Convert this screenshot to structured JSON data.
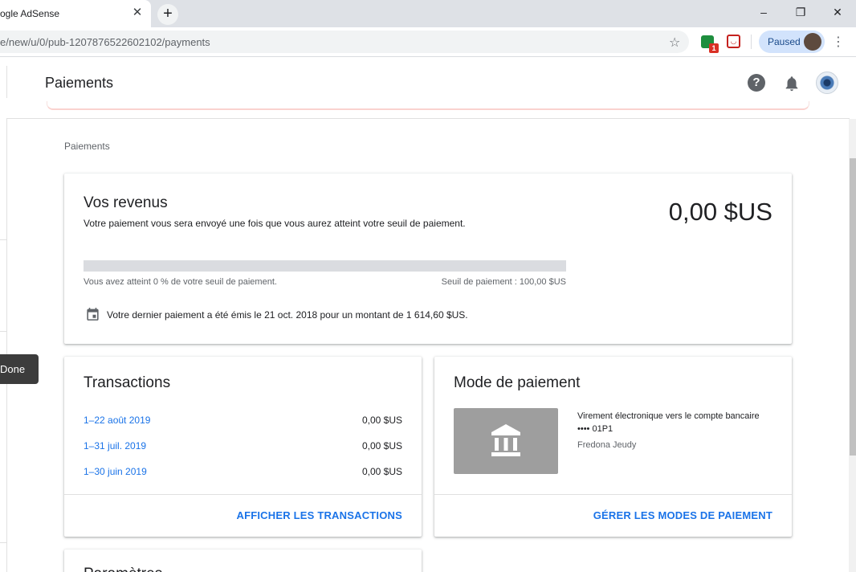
{
  "browser": {
    "tab_title": "ogle AdSense",
    "url": "e/new/u/0/pub-1207876522602102/payments",
    "extension_badge": "1",
    "profile_status": "Paused"
  },
  "app": {
    "page_title": "Paiements",
    "breadcrumb": "Paiements"
  },
  "tooltip": {
    "label": "Done"
  },
  "revenue": {
    "title": "Vos revenus",
    "description": "Votre paiement vous sera envoyé une fois que vous aurez atteint votre seuil de paiement.",
    "amount": "0,00 $US",
    "progress_percent": 0,
    "progress_text": "Vous avez atteint 0 % de votre seuil de paiement.",
    "threshold_text": "Seuil de paiement : 100,00 $US",
    "last_payment": "Votre dernier paiement a été émis le 21 oct. 2018 pour un montant de 1 614,60 $US."
  },
  "transactions": {
    "title": "Transactions",
    "rows": [
      {
        "period": "1–22 août 2019",
        "amount": "0,00 $US"
      },
      {
        "period": "1–31 juil. 2019",
        "amount": "0,00 $US"
      },
      {
        "period": "1–30 juin 2019",
        "amount": "0,00 $US"
      }
    ],
    "action": "AFFICHER LES TRANSACTIONS"
  },
  "payment_method": {
    "title": "Mode de paiement",
    "description": "Virement électronique vers le compte bancaire •••• 01P1",
    "holder": "Fredona Jeudy",
    "action": "GÉRER LES MODES DE PAIEMENT"
  },
  "params": {
    "title": "Paramètres"
  },
  "colors": {
    "accent": "#1a73e8",
    "bank_box": "#9e9e9e"
  }
}
